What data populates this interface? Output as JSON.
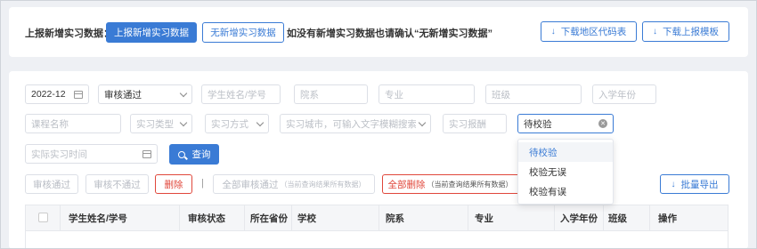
{
  "report_bar": {
    "label": "上报新增实习数据：",
    "report_button": "上报新增实习数据",
    "no_new_button": "无新增实习数据",
    "hint": "如没有新增实习数据也请确认“无新增实习数据”",
    "download_region_codes": "下载地区代码表",
    "download_template": "下载上报模板"
  },
  "filters": {
    "month": {
      "value": "2022-12"
    },
    "review_status": {
      "value": "审核通过"
    },
    "student_name": {
      "placeholder": "学生姓名/学号"
    },
    "department": {
      "placeholder": "院系"
    },
    "major": {
      "placeholder": "专业"
    },
    "class": {
      "placeholder": "班级"
    },
    "enroll_year": {
      "placeholder": "入学年份"
    },
    "course_name": {
      "placeholder": "课程名称"
    },
    "internship_type": {
      "placeholder": "实习类型"
    },
    "internship_mode": {
      "placeholder": "实习方式"
    },
    "internship_city": {
      "placeholder": "实习城市，可输入文字模糊搜索"
    },
    "internship_pay": {
      "placeholder": "实习报酬"
    },
    "validation": {
      "value": "待校验"
    },
    "actual_time": {
      "placeholder": "实际实习时间"
    },
    "query_button": "查询"
  },
  "validation_dropdown": {
    "options": [
      "待校验",
      "校验无误",
      "校验有误"
    ],
    "selected_index": 0
  },
  "actions": {
    "approve": "审核通过",
    "reject": "审核不通过",
    "delete": "删除",
    "separator": "|",
    "approve_all": "全部审核通过",
    "approve_all_note": "（当前查询结果所有数据）",
    "delete_all": "全部删除",
    "delete_all_note": "（当前查询结果所有数据）",
    "batch_export": "批量导出"
  },
  "table": {
    "columns": [
      "学生姓名/学号",
      "审核状态",
      "所在省份",
      "学校",
      "院系",
      "专业",
      "入学年份",
      "班级",
      "操作"
    ]
  },
  "colors": {
    "primary": "#3a7bd5",
    "danger": "#e0473b",
    "page_bg": "#eef0f4"
  }
}
